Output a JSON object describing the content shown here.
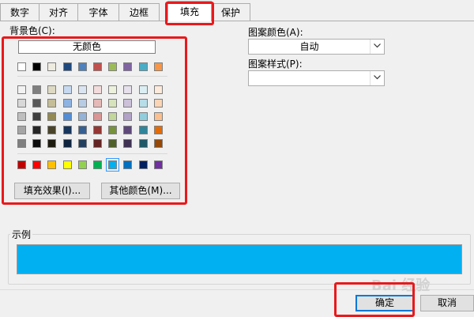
{
  "tabs": [
    {
      "label": "数字"
    },
    {
      "label": "对齐"
    },
    {
      "label": "字体"
    },
    {
      "label": "边框"
    },
    {
      "label": "填充",
      "active": true
    },
    {
      "label": "保护"
    }
  ],
  "background": {
    "label": "背景色(C):",
    "no_color": "无颜色",
    "theme_row": [
      "#ffffff",
      "#000000",
      "#eeece1",
      "#1f497d",
      "#4f81bd",
      "#c0504d",
      "#9bbb59",
      "#8064a2",
      "#4bacc6",
      "#f79646"
    ],
    "tint_rows": [
      [
        "#f2f2f2",
        "#7f7f7f",
        "#ddd9c3",
        "#c6d9f0",
        "#dbe5f1",
        "#f2dcdb",
        "#ebf1dd",
        "#e5e0ec",
        "#dbeef3",
        "#fdeada"
      ],
      [
        "#d8d8d8",
        "#595959",
        "#c4bd97",
        "#8db3e2",
        "#b8cce4",
        "#e5b9b7",
        "#d7e3bc",
        "#ccc1d9",
        "#b7dde8",
        "#fbd5b5"
      ],
      [
        "#bfbfbf",
        "#3f3f3f",
        "#938953",
        "#548dd4",
        "#95b3d7",
        "#d99694",
        "#c3d69b",
        "#b2a2c7",
        "#92cddc",
        "#fac08f"
      ],
      [
        "#a5a5a5",
        "#262626",
        "#494429",
        "#17365d",
        "#366092",
        "#953734",
        "#76923c",
        "#5f497a",
        "#31859b",
        "#e36c09"
      ],
      [
        "#7f7f7f",
        "#0c0c0c",
        "#1d1b10",
        "#0f243e",
        "#244061",
        "#632423",
        "#4f6128",
        "#3f3151",
        "#205867",
        "#974806"
      ]
    ],
    "standard_row": [
      "#c00000",
      "#ff0000",
      "#ffc000",
      "#ffff00",
      "#92d050",
      "#00b050",
      "#00b0f0",
      "#0070c0",
      "#002060",
      "#7030a0"
    ],
    "selected_color": "#00b0f0",
    "fill_effects_button": "填充效果(I)...",
    "more_colors_button": "其他颜色(M)..."
  },
  "pattern": {
    "color_label": "图案颜色(A):",
    "color_value": "自动",
    "style_label": "图案样式(P):",
    "style_value": ""
  },
  "sample": {
    "label": "示例",
    "color": "#00b0f0"
  },
  "footer": {
    "ok": "确定",
    "cancel": "取消"
  },
  "watermark": "Bai 经验"
}
